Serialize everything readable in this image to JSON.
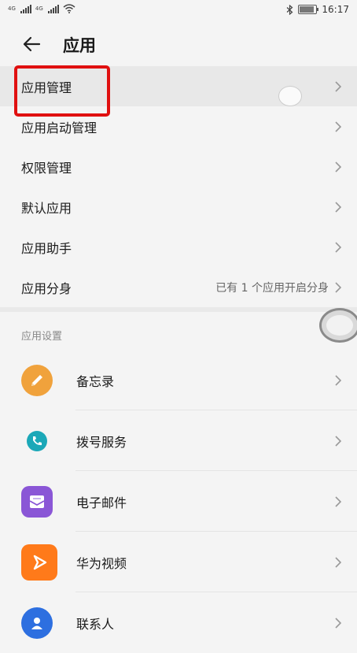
{
  "status_bar": {
    "network_tag_1": "4G",
    "network_tag_2": "4G",
    "battery_text": "100",
    "battery_level": 1.0,
    "time": "16:17"
  },
  "header": {
    "title": "应用"
  },
  "menu": [
    {
      "label": "应用管理",
      "value": ""
    },
    {
      "label": "应用启动管理",
      "value": ""
    },
    {
      "label": "权限管理",
      "value": ""
    },
    {
      "label": "默认应用",
      "value": ""
    },
    {
      "label": "应用助手",
      "value": ""
    },
    {
      "label": "应用分身",
      "value": "已有 1 个应用开启分身"
    }
  ],
  "section": {
    "title": "应用设置"
  },
  "apps": [
    {
      "label": "备忘录",
      "icon": "notepad-icon",
      "color": "#f0a23c"
    },
    {
      "label": "拨号服务",
      "icon": "phone-icon",
      "color": "#1ba8b8"
    },
    {
      "label": "电子邮件",
      "icon": "mail-icon",
      "color": "#8a56d6"
    },
    {
      "label": "华为视频",
      "icon": "video-play-icon",
      "color": "#ff7a1a"
    },
    {
      "label": "联系人",
      "icon": "contact-icon",
      "color": "#2d6fe0"
    }
  ],
  "colors": {
    "highlight_box": "#e01010",
    "background": "#f4f4f4"
  }
}
